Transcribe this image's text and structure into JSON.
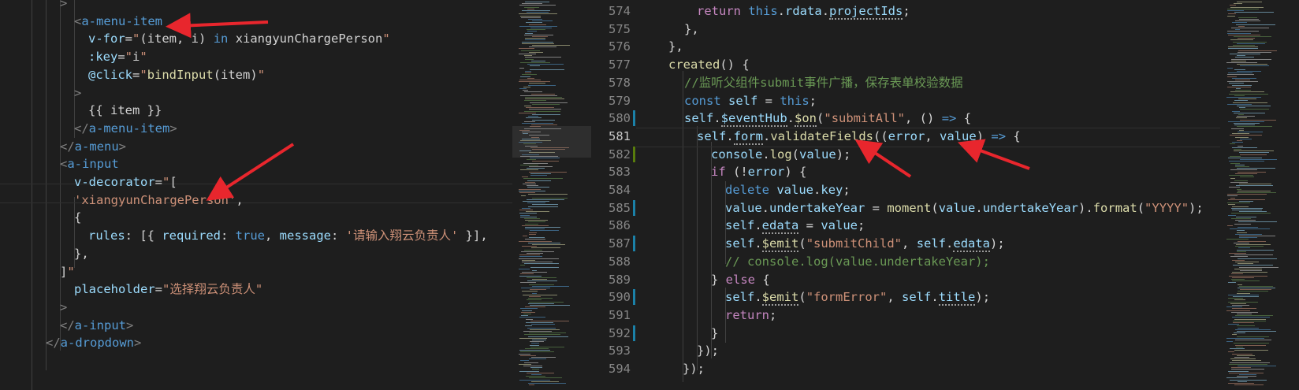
{
  "left_editor": {
    "lines": [
      [
        [
          "t-br",
          ">"
        ]
      ],
      [
        [
          "t-br",
          "<"
        ],
        [
          "t-tag",
          "a-menu-item"
        ]
      ],
      [
        [
          "t-at",
          "v-for"
        ],
        [
          "t-op",
          "="
        ],
        [
          "t-str",
          "\""
        ],
        [
          "t-txt",
          "(item, i) "
        ],
        [
          "t-kw",
          "in"
        ],
        [
          "t-txt",
          " xiangyunChargePerson"
        ],
        [
          "t-str",
          "\""
        ]
      ],
      [
        [
          "t-at",
          ":key"
        ],
        [
          "t-op",
          "="
        ],
        [
          "t-str",
          "\""
        ],
        [
          "t-txt",
          "i"
        ],
        [
          "t-str",
          "\""
        ]
      ],
      [
        [
          "t-at",
          "@click"
        ],
        [
          "t-op",
          "="
        ],
        [
          "t-str",
          "\""
        ],
        [
          "t-fn",
          "bindInput"
        ],
        [
          "t-txt",
          "(item)"
        ],
        [
          "t-str",
          "\""
        ]
      ],
      [
        [
          "t-br",
          ">"
        ]
      ],
      [
        [
          "t-txt",
          "{{ item }}"
        ]
      ],
      [
        [
          "t-br",
          "</"
        ],
        [
          "t-tag",
          "a-menu-item"
        ],
        [
          "t-br",
          ">"
        ]
      ],
      [
        [
          "t-br",
          "</"
        ],
        [
          "t-tag",
          "a-menu"
        ],
        [
          "t-br",
          ">"
        ]
      ],
      [
        [
          "t-br",
          "<"
        ],
        [
          "t-tag",
          "a-input"
        ]
      ],
      [
        [
          "t-at",
          "v-decorator"
        ],
        [
          "t-op",
          "="
        ],
        [
          "t-str",
          "\""
        ],
        [
          "t-txt",
          "["
        ]
      ],
      [
        [
          "t-str",
          "'xiangyunChargePerson'"
        ],
        [
          "t-txt",
          ","
        ]
      ],
      [
        [
          "t-txt",
          "{"
        ]
      ],
      [
        [
          "t-var",
          "rules"
        ],
        [
          "t-txt",
          ": [{ "
        ],
        [
          "t-var",
          "required"
        ],
        [
          "t-txt",
          ": "
        ],
        [
          "t-kw",
          "true"
        ],
        [
          "t-txt",
          ", "
        ],
        [
          "t-var",
          "message"
        ],
        [
          "t-txt",
          ": "
        ],
        [
          "t-str",
          "'请输入翔云负责人'"
        ],
        [
          "t-txt",
          " }],"
        ]
      ],
      [
        [
          "t-txt",
          "},"
        ]
      ],
      [
        [
          "t-txt",
          "]"
        ],
        [
          "t-str",
          "\""
        ]
      ],
      [
        [
          "t-at",
          "placeholder"
        ],
        [
          "t-op",
          "="
        ],
        [
          "t-str",
          "\"选择翔云负责人\""
        ]
      ],
      [
        [
          "t-br",
          ">"
        ]
      ],
      [
        [
          "t-br",
          "</"
        ],
        [
          "t-tag",
          "a-input"
        ],
        [
          "t-br",
          ">"
        ]
      ],
      [
        [
          "t-br",
          "</"
        ],
        [
          "t-tag",
          "a-dropdown"
        ],
        [
          "t-br",
          ">"
        ]
      ]
    ]
  },
  "right_editor": {
    "line_numbers": [
      "574",
      "575",
      "576",
      "577",
      "578",
      "579",
      "580",
      "581",
      "582",
      "583",
      "584",
      "585",
      "586",
      "587",
      "588",
      "589",
      "590",
      "591",
      "592",
      "593",
      "594"
    ],
    "active_line": "581",
    "lines": [
      [
        [
          "t-ctl",
          "return"
        ],
        [
          "t-txt",
          " "
        ],
        [
          "t-kw",
          "this"
        ],
        [
          "t-txt",
          "."
        ],
        [
          "t-var",
          "rdata"
        ],
        [
          "t-txt",
          "."
        ],
        [
          "t-var",
          "projectIds"
        ],
        [
          "t-txt",
          ";"
        ]
      ],
      [
        [
          "t-txt",
          "},"
        ]
      ],
      [
        [
          "t-txt",
          "},"
        ]
      ],
      [
        [
          "t-fn",
          "created"
        ],
        [
          "t-txt",
          "() {"
        ]
      ],
      [
        [
          "t-cm",
          "//监听父组件submit事件广播，保存表单校验数据"
        ]
      ],
      [
        [
          "t-kw",
          "const"
        ],
        [
          "t-txt",
          " "
        ],
        [
          "t-var",
          "self"
        ],
        [
          "t-txt",
          " = "
        ],
        [
          "t-kw",
          "this"
        ],
        [
          "t-txt",
          ";"
        ]
      ],
      [
        [
          "t-var",
          "self"
        ],
        [
          "t-txt",
          "."
        ],
        [
          "t-var",
          "$eventHub"
        ],
        [
          "t-txt",
          "."
        ],
        [
          "t-fn",
          "$on"
        ],
        [
          "t-txt",
          "("
        ],
        [
          "t-str",
          "\"submitAll\""
        ],
        [
          "t-txt",
          ", () "
        ],
        [
          "t-kw",
          "=>"
        ],
        [
          "t-txt",
          " {"
        ]
      ],
      [
        [
          "t-var",
          "self"
        ],
        [
          "t-txt",
          "."
        ],
        [
          "t-var",
          "form"
        ],
        [
          "t-txt",
          "."
        ],
        [
          "t-fn",
          "validateFields"
        ],
        [
          "t-txt",
          "(("
        ],
        [
          "t-var",
          "error"
        ],
        [
          "t-txt",
          ", "
        ],
        [
          "t-var",
          "value"
        ],
        [
          "t-txt",
          ") "
        ],
        [
          "t-kw",
          "=>"
        ],
        [
          "t-txt",
          " {"
        ]
      ],
      [
        [
          "t-var",
          "console"
        ],
        [
          "t-txt",
          "."
        ],
        [
          "t-fn",
          "log"
        ],
        [
          "t-txt",
          "("
        ],
        [
          "t-var",
          "value"
        ],
        [
          "t-txt",
          ");"
        ]
      ],
      [
        [
          "t-ctl",
          "if"
        ],
        [
          "t-txt",
          " (!"
        ],
        [
          "t-var",
          "error"
        ],
        [
          "t-txt",
          ") {"
        ]
      ],
      [
        [
          "t-kw",
          "delete"
        ],
        [
          "t-txt",
          " "
        ],
        [
          "t-var",
          "value"
        ],
        [
          "t-txt",
          "."
        ],
        [
          "t-var",
          "key"
        ],
        [
          "t-txt",
          ";"
        ]
      ],
      [
        [
          "t-var",
          "value"
        ],
        [
          "t-txt",
          "."
        ],
        [
          "t-var",
          "undertakeYear"
        ],
        [
          "t-txt",
          " = "
        ],
        [
          "t-fn",
          "moment"
        ],
        [
          "t-txt",
          "("
        ],
        [
          "t-var",
          "value"
        ],
        [
          "t-txt",
          "."
        ],
        [
          "t-var",
          "undertakeYear"
        ],
        [
          "t-txt",
          ")."
        ],
        [
          "t-fn",
          "format"
        ],
        [
          "t-txt",
          "("
        ],
        [
          "t-str",
          "\"YYYY\""
        ],
        [
          "t-txt",
          ");"
        ]
      ],
      [
        [
          "t-var",
          "self"
        ],
        [
          "t-txt",
          "."
        ],
        [
          "t-var",
          "edata"
        ],
        [
          "t-txt",
          " = "
        ],
        [
          "t-var",
          "value"
        ],
        [
          "t-txt",
          ";"
        ]
      ],
      [
        [
          "t-var",
          "self"
        ],
        [
          "t-txt",
          "."
        ],
        [
          "t-fn",
          "$emit"
        ],
        [
          "t-txt",
          "("
        ],
        [
          "t-str",
          "\"submitChild\""
        ],
        [
          "t-txt",
          ", "
        ],
        [
          "t-var",
          "self"
        ],
        [
          "t-txt",
          "."
        ],
        [
          "t-var",
          "edata"
        ],
        [
          "t-txt",
          ");"
        ]
      ],
      [
        [
          "t-cm",
          "// console.log(value.undertakeYear);"
        ]
      ],
      [
        [
          "t-txt",
          "} "
        ],
        [
          "t-ctl",
          "else"
        ],
        [
          "t-txt",
          " {"
        ]
      ],
      [
        [
          "t-var",
          "self"
        ],
        [
          "t-txt",
          "."
        ],
        [
          "t-fn",
          "$emit"
        ],
        [
          "t-txt",
          "("
        ],
        [
          "t-str",
          "\"formError\""
        ],
        [
          "t-txt",
          ", "
        ],
        [
          "t-var",
          "self"
        ],
        [
          "t-txt",
          "."
        ],
        [
          "t-var",
          "title"
        ],
        [
          "t-txt",
          ");"
        ]
      ],
      [
        [
          "t-ctl",
          "return"
        ],
        [
          "t-txt",
          ";"
        ]
      ],
      [
        [
          "t-txt",
          "}"
        ]
      ],
      [
        [
          "t-txt",
          "});"
        ]
      ],
      [
        [
          "t-txt",
          "});"
        ]
      ]
    ]
  },
  "colors": {
    "annotation_arrow": "#e8262d",
    "background": "#1e1e1e",
    "modified_gutter": "#1b81a8",
    "added_gutter": "#587c0c"
  },
  "icons": [
    "annotation-arrow-icon"
  ]
}
